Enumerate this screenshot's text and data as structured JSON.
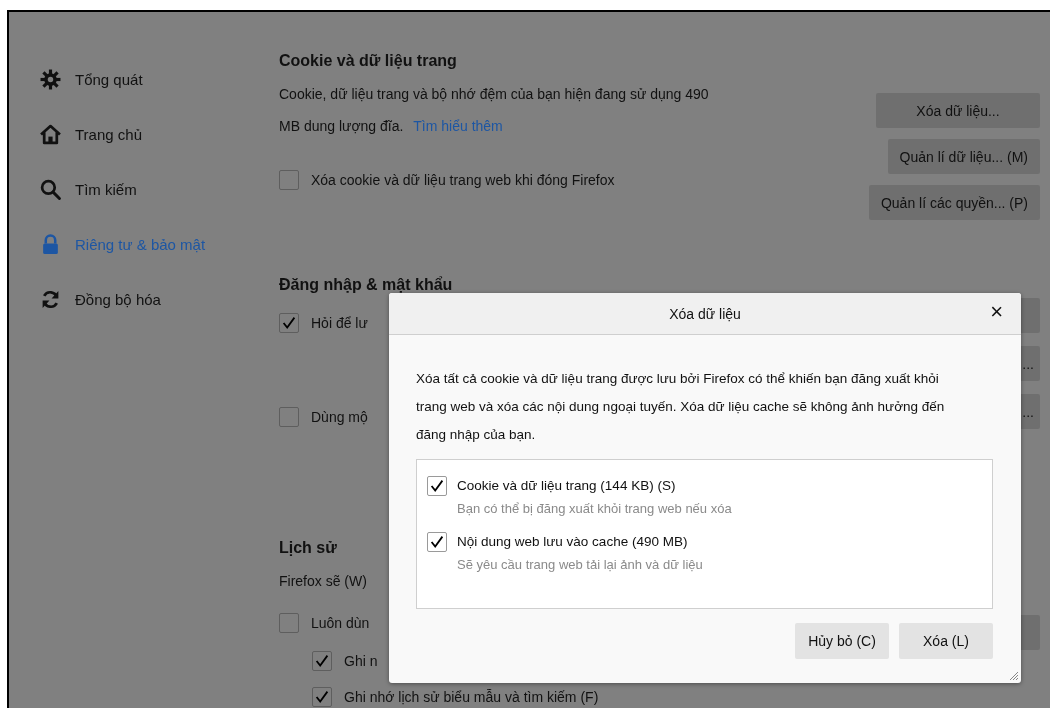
{
  "sidebar": {
    "items": [
      {
        "label": "Tổng quát",
        "selected": false
      },
      {
        "label": "Trang chủ",
        "selected": false
      },
      {
        "label": "Tìm kiếm",
        "selected": false
      },
      {
        "label": "Riêng tư & bảo mật",
        "selected": true
      },
      {
        "label": "Đồng bộ hóa",
        "selected": false
      }
    ]
  },
  "cookies": {
    "heading": "Cookie và dữ liệu trang",
    "text": "Cookie, dữ liệu trang và bộ nhớ đệm của bạn hiện đang sử dụng 490 MB dung lượng đĩa.",
    "link": "Tìm hiểu thêm",
    "checkbox": {
      "label": "Xóa cookie và dữ liệu trang web khi đóng Firefox",
      "checked": false
    },
    "buttons": [
      "Xóa dữ liệu...",
      "Quản lí dữ liệu... (M)",
      "Quản lí các quyền... (P)"
    ]
  },
  "logins": {
    "heading": "Đăng nhập & mật khẩu",
    "checkboxes": [
      {
        "label": "Hỏi để lư",
        "checked": true
      },
      {
        "label": "Dùng mộ",
        "checked": false
      }
    ],
    "buttons": [
      "...",
      "..."
    ]
  },
  "history": {
    "heading": "Lịch sử",
    "text": "Firefox sẽ (W)",
    "checkboxes": [
      {
        "label": "Luôn dùn",
        "checked": false,
        "children": [
          {
            "label": "Ghi n",
            "checked": true
          },
          {
            "label": "Ghi nhớ lịch sử biểu mẫu và tìm kiếm (F)",
            "checked": true
          }
        ]
      }
    ]
  },
  "dialog": {
    "title": "Xóa dữ liệu",
    "close": "×",
    "text": "Xóa tất cả cookie và dữ liệu trang được lưu bởi Firefox có thể khiến bạn đăng xuất khỏi trang web và xóa các nội dung ngoại tuyến. Xóa dữ liệu cache sẽ không ảnh hưởng đến đăng nhập của bạn.",
    "options": [
      {
        "label": "Cookie và dữ liệu trang (144 KB) (S)",
        "hint": "Bạn có thể bị đăng xuất khỏi trang web nếu xóa",
        "checked": true
      },
      {
        "label": "Nội dung web lưu vào cache (490 MB)",
        "hint": "Sẽ yêu cầu trang web tải lại ảnh và dữ liệu",
        "checked": true
      }
    ],
    "buttons": [
      "Hủy bỏ (C)",
      "Xóa (L)"
    ]
  }
}
